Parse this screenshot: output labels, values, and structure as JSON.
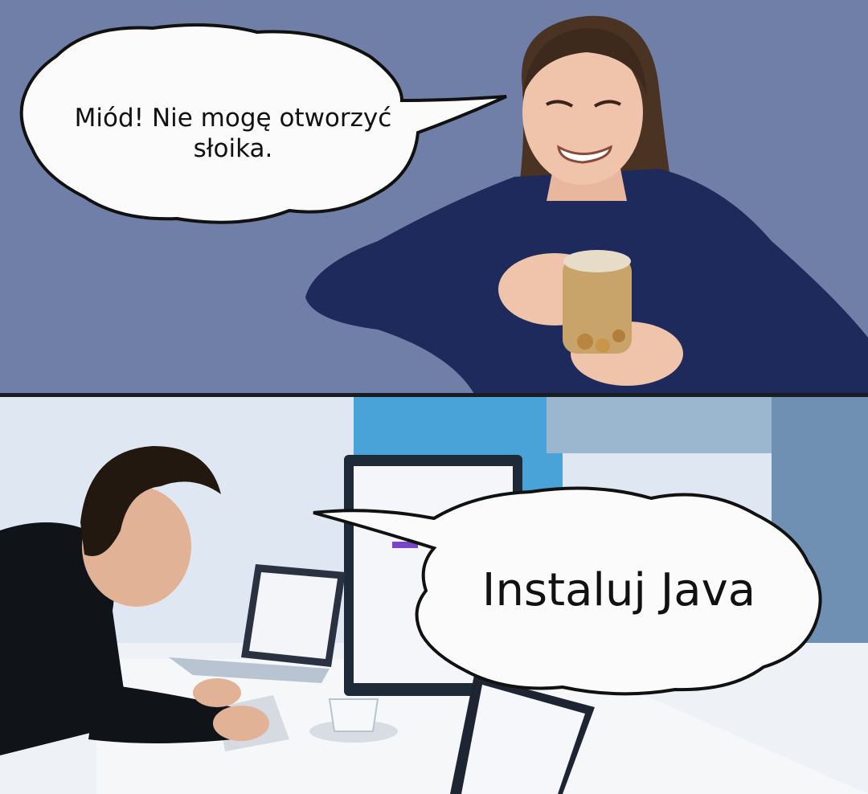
{
  "meme": {
    "top_panel": {
      "speech": "Miód! Nie mogę otworzyć słoika."
    },
    "bottom_panel": {
      "speech": "Instaluj Java"
    }
  },
  "colors": {
    "top_background": "#6f7fa8",
    "sweater": "#1e2a5c",
    "bubble_fill": "#fbfbfb",
    "bubble_stroke": "#111111",
    "office_wall": "#dfe8f2",
    "window_blue": "#4aa3d8"
  }
}
